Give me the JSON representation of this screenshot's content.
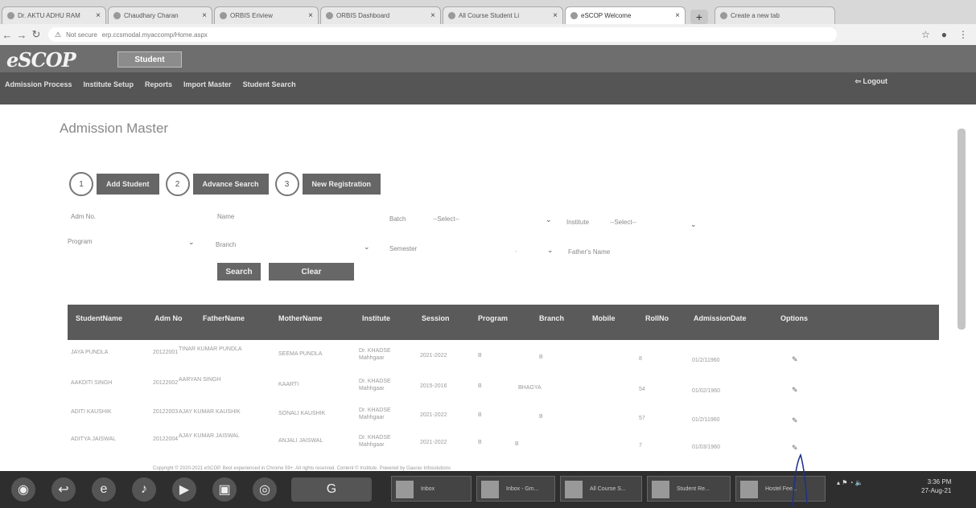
{
  "browser": {
    "tabs": [
      {
        "label": "Dr. AKTU ADHU RAM",
        "active": false
      },
      {
        "label": "Chaudhary Charan",
        "active": false
      },
      {
        "label": "ORBIS Eriview",
        "active": false
      },
      {
        "label": "ORBIS Dashboard",
        "active": false
      },
      {
        "label": "All Course Student Li",
        "active": false
      },
      {
        "label": "eSCOP Welcome",
        "active": true
      }
    ],
    "new_tab": "+",
    "url_security": "Not secure",
    "url": "erp.ccsmodal.myaccomp/Home.aspx",
    "profile_tab_label": "Create a new tab"
  },
  "app": {
    "logo": "eSCOP",
    "role_button": "Student",
    "menu": [
      "Admission Process",
      "Institute Setup",
      "Reports",
      "Import Master",
      "Student Search"
    ],
    "logout": "Logout"
  },
  "page": {
    "title": "Admission Master",
    "steps": [
      {
        "num": "1",
        "label": "Add Student"
      },
      {
        "num": "2",
        "label": "Advance Search"
      },
      {
        "num": "3",
        "label": "New Registration"
      }
    ],
    "filters": {
      "adm_no_label": "Adm No.",
      "name_label": "Name",
      "batch_label": "Batch",
      "batch_value": "--Select--",
      "institute_label": "Institute",
      "institute_value": "--Select--",
      "program_label": "Program",
      "branch_label": "Branch",
      "semester_label": "Semester",
      "semester_value": ".",
      "fathers_name_label": "Father's Name"
    },
    "search_button": "Search",
    "clear_button": "Clear"
  },
  "table": {
    "headers": [
      "StudentName",
      "Adm No",
      "FatherName",
      "MotherName",
      "Institute",
      "Session",
      "Program",
      "Branch",
      "Mobile",
      "RollNo",
      "AdmissionDate",
      "Options"
    ],
    "rows": [
      {
        "student": "JAYA PUNDLA",
        "adm": "20122001",
        "father": "TINAR KUMAR PUNDLA",
        "mother": "SEEMA PUNDLA",
        "institute": "Dr. KHADSE Mahhgaar",
        "session": "2021-2022",
        "program": "B",
        "branch": "B",
        "mobile": "",
        "roll": "8",
        "date": "01/2/11960"
      },
      {
        "student": "AAKDITI SINGH",
        "adm": "20122002",
        "father": "AARYAN SINGH",
        "mother": "KAARTI",
        "institute": "Dr. KHADSE Mahhgaar",
        "session": "2015-2016",
        "program": "B",
        "branch": "BHAGYA",
        "mobile": "",
        "roll": "54",
        "date": "01/02/1960"
      },
      {
        "student": "ADITI KAUSHIK",
        "adm": "20122003",
        "father": "AJAY KUMAR KAUSHIK",
        "mother": "SONALI KAUSHIK",
        "institute": "Dr. KHADSE Mahhgaar",
        "session": "2021-2022",
        "program": "B",
        "branch": "B",
        "mobile": "",
        "roll": "57",
        "date": "01/2/11960"
      },
      {
        "student": "ADITYA JAISWAL",
        "adm": "20122004",
        "father": "AJAY KUMAR JAISWAL",
        "mother": "ANJALI JAISWAL",
        "institute": "Dr. KHADSE Mahhgaar",
        "session": "2021-2022",
        "program": "B",
        "branch": "B",
        "mobile": "",
        "roll": "7",
        "date": "01/03/1960"
      }
    ],
    "edit_icon": "✎"
  },
  "footer_note": "Copyright © 2020-2021 eSCOP. Best experienced in Chrome 59+. All rights reserved. Content © Institute. Powered by Gaurav Infosolutions",
  "taskbar": {
    "tasks": [
      "Inbox",
      "Inbox - Gm...",
      "All Course S...",
      "Student Re...",
      "Hostel Fee..."
    ],
    "clock_time": "3:36 PM",
    "clock_date": "27-Aug-21"
  },
  "colors": {
    "header_bg": "#6e6e6e",
    "menu_bg": "#555555",
    "table_header_bg": "#5a5a5a",
    "button_bg": "#676767",
    "taskbar_bg": "#2e2e2e"
  }
}
